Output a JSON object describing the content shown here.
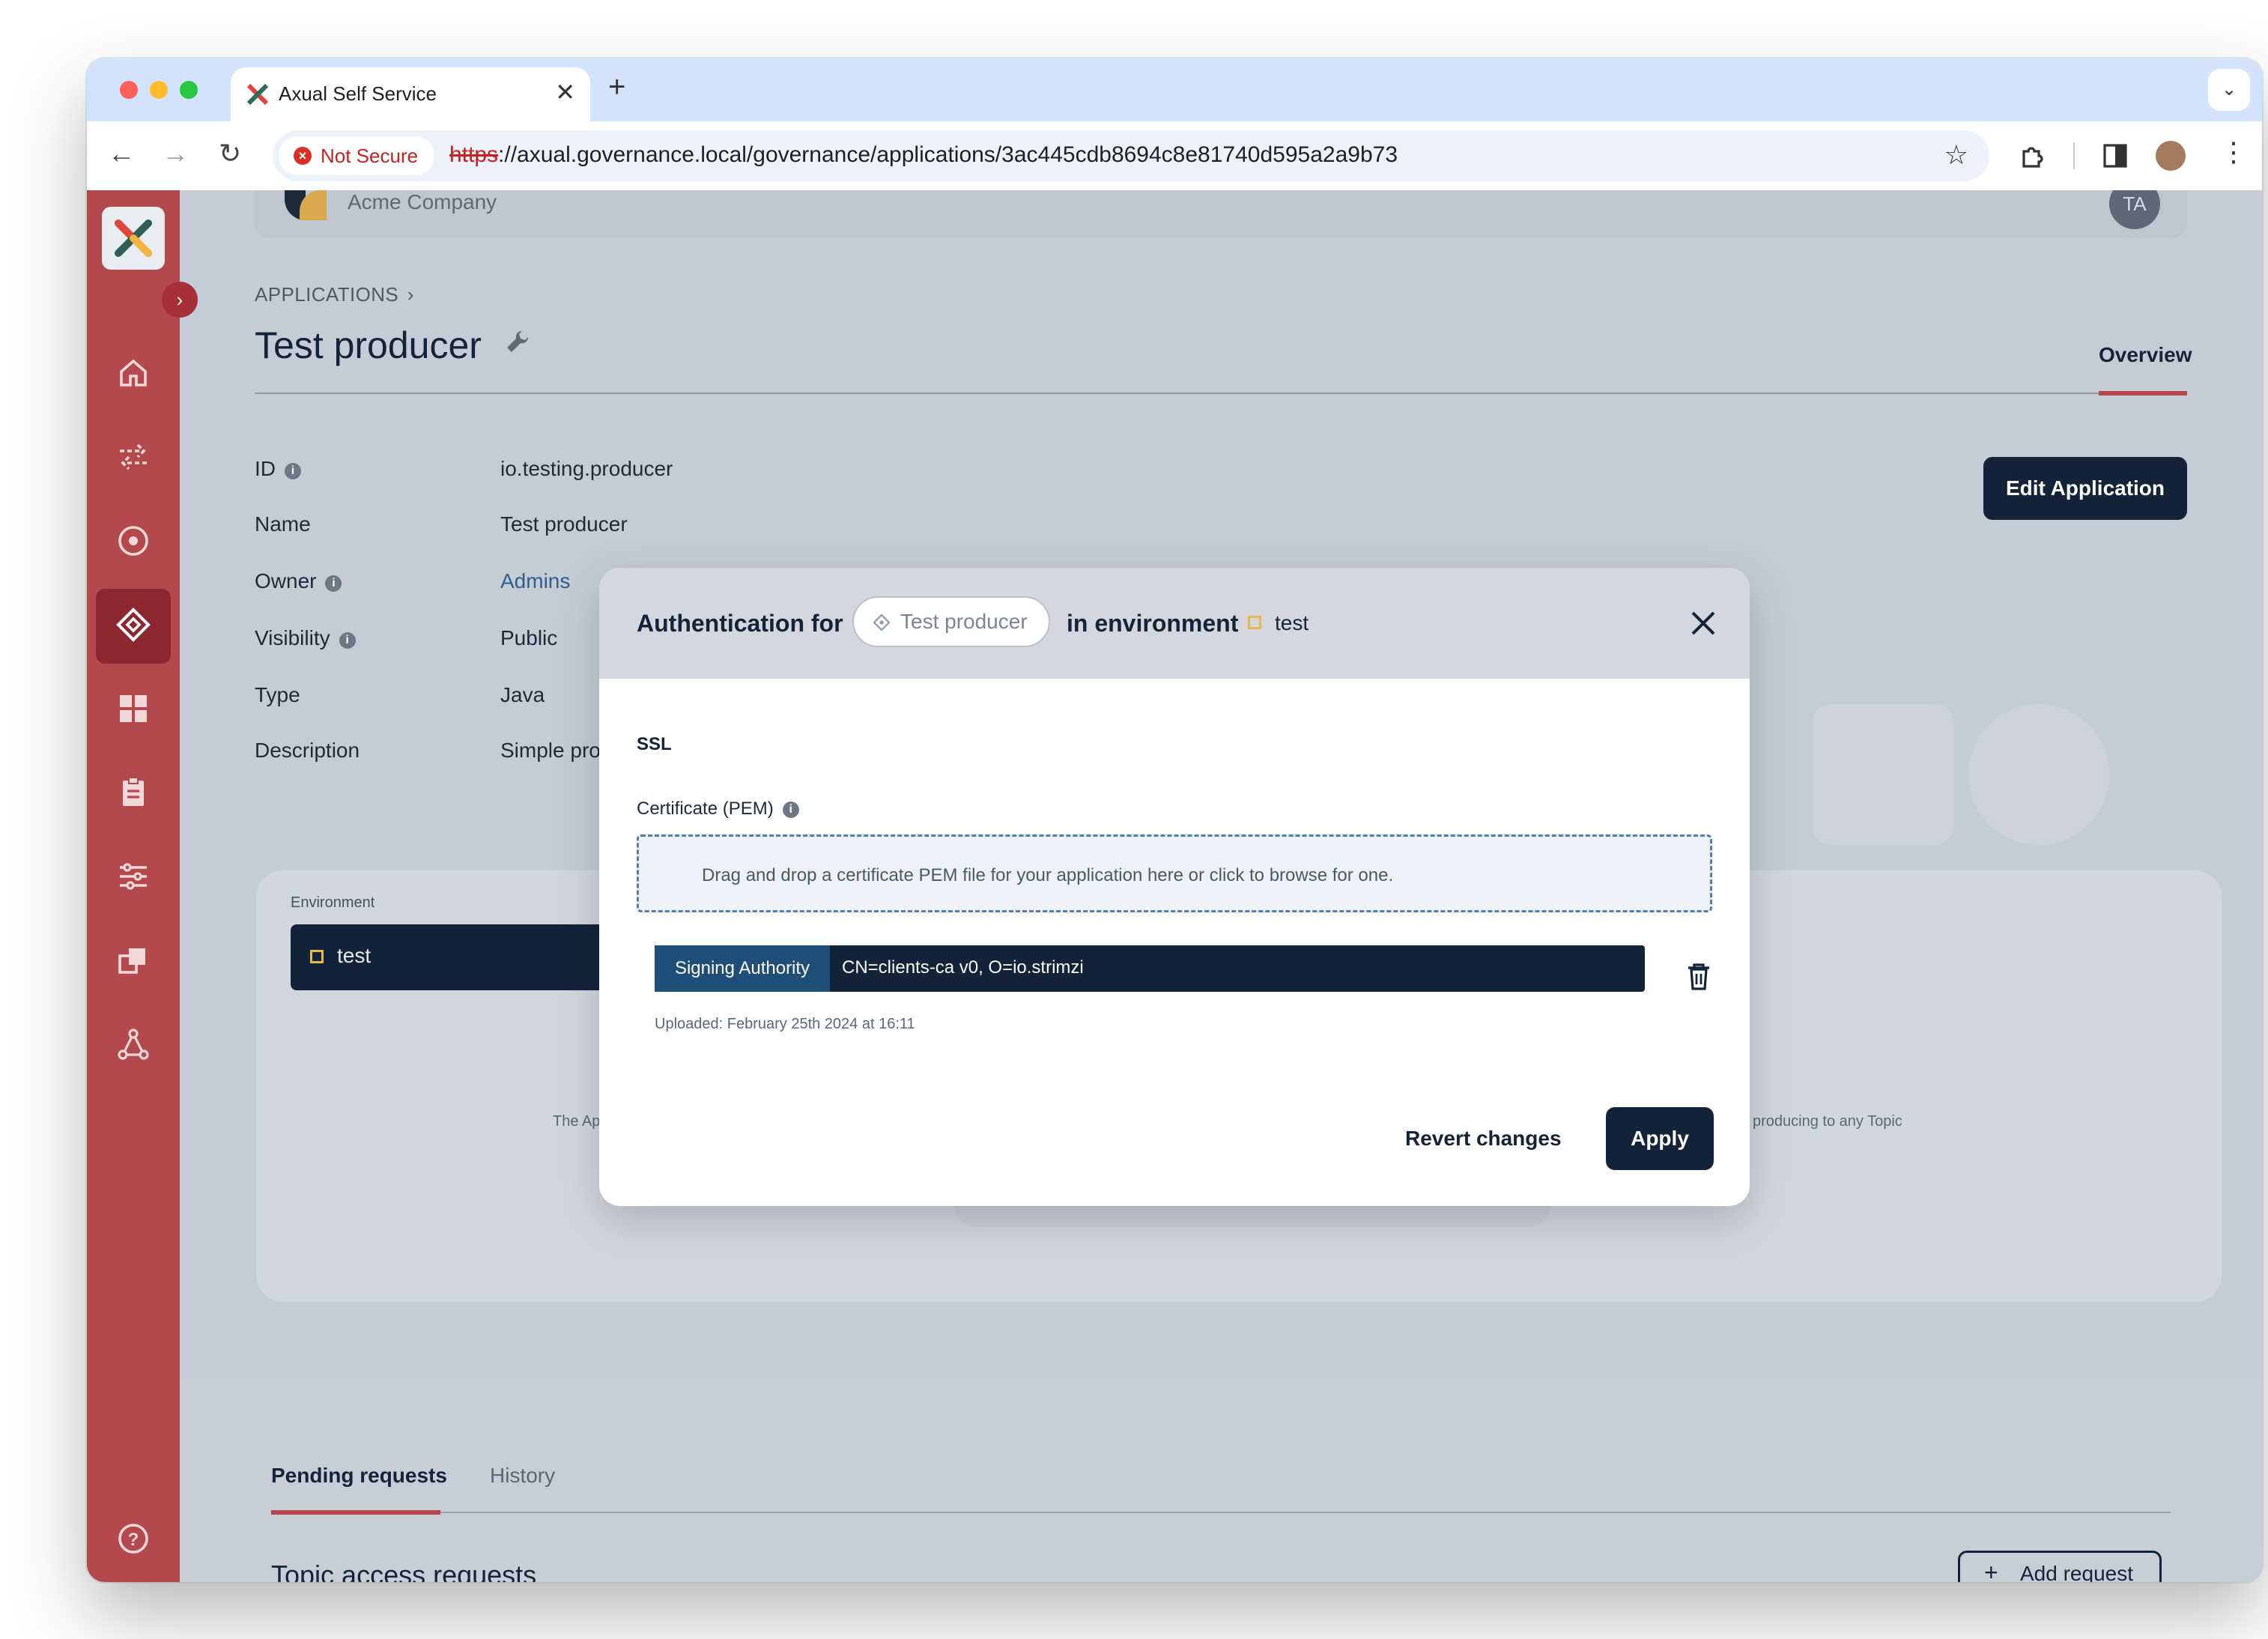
{
  "browser": {
    "tab_title": "Axual Self Service",
    "security_label": "Not Secure",
    "url_scheme": "https",
    "url_rest": "://axual.governance.local/governance/applications/3ac445cdb8694c8e81740d595a2a9b73"
  },
  "header": {
    "company": "Acme Company",
    "avatar_initials": "TA"
  },
  "breadcrumb": {
    "label": "APPLICATIONS"
  },
  "page": {
    "title": "Test producer",
    "tab_overview": "Overview",
    "edit_button": "Edit Application"
  },
  "details": {
    "id_label": "ID",
    "id_value": "io.testing.producer",
    "name_label": "Name",
    "name_value": "Test producer",
    "owner_label": "Owner",
    "owner_value": "Admins",
    "visibility_label": "Visibility",
    "visibility_value": "Public",
    "type_label": "Type",
    "type_value": "Java",
    "description_label": "Description",
    "description_value": "Simple pro"
  },
  "environment": {
    "label": "Environment",
    "selected": "test",
    "left_hint": "The Ap",
    "right_hint": "producing to any Topic"
  },
  "bottom": {
    "tab_pending": "Pending requests",
    "tab_history": "History",
    "section_title": "Topic access requests",
    "add_request": "Add request"
  },
  "modal": {
    "title_prefix": "Authentication for",
    "app_pill": "Test producer",
    "in_env": "in environment",
    "env_name": "test",
    "ssl_label": "SSL",
    "cert_label": "Certificate (PEM)",
    "dropzone_text": "Drag and drop a certificate PEM file for your application here or click to browse for one.",
    "signing_authority": "Signing Authority",
    "cert_cn": "CN=clients-ca v0, O=io.strimzi",
    "uploaded": "Uploaded: February 25th 2024 at 16:11",
    "revert": "Revert changes",
    "apply": "Apply"
  },
  "colors": {
    "sidebar": "#b3484d",
    "navy": "#13243a",
    "accent_red": "#b3484d",
    "link": "#2e5f8f"
  }
}
